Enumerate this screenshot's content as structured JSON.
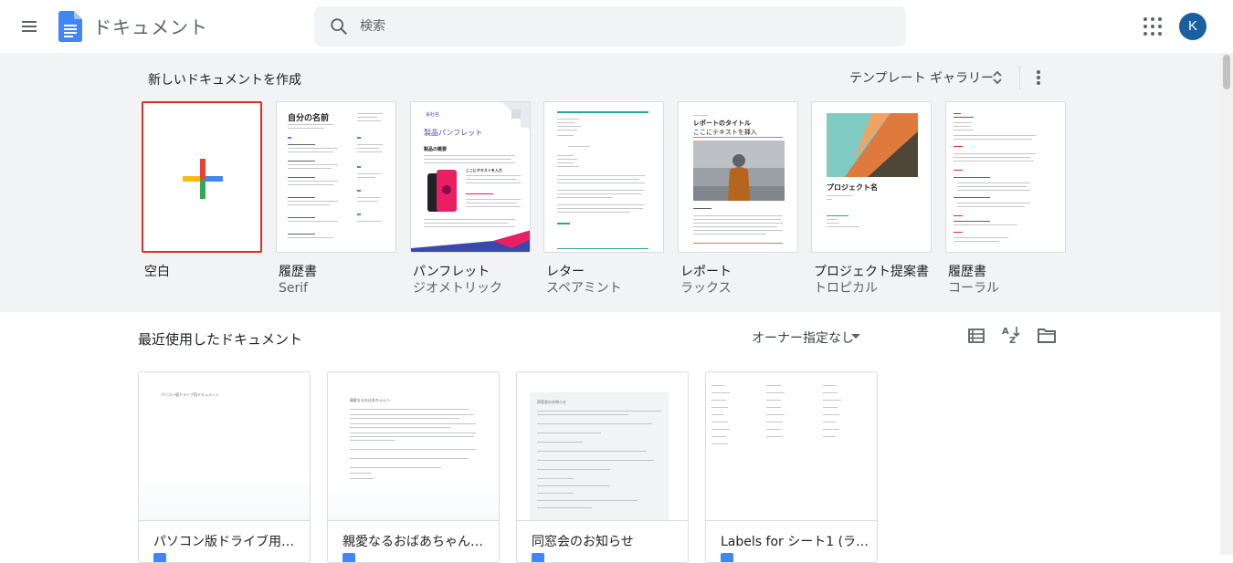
{
  "app": {
    "title": "ドキュメント",
    "avatar_letter": "K",
    "brand_color": "#4285f4"
  },
  "search": {
    "placeholder": "検索"
  },
  "templates": {
    "section_title": "新しいドキュメントを作成",
    "gallery_label": "テンプレート ギャラリー",
    "items": [
      {
        "name": "空白",
        "sub": ""
      },
      {
        "name": "履歴書",
        "sub": "Serif"
      },
      {
        "name": "パンフレット",
        "sub": "ジオメトリック"
      },
      {
        "name": "レター",
        "sub": "スペアミント"
      },
      {
        "name": "レポート",
        "sub": "ラックス"
      },
      {
        "name": "プロジェクト提案書",
        "sub": "トロピカル"
      },
      {
        "name": "履歴書",
        "sub": "コーラル"
      }
    ],
    "previews": {
      "resume_serif_name": "自分の名前",
      "brochure_company": "会社名",
      "brochure_title": "製品パンフレット",
      "brochure_heading": "製品の概要",
      "brochure_caption": "ここにテキストを入力",
      "report_title": "レポートのタイトル",
      "report_subtitle": "ここにテキストを挿入",
      "proposal_title": "プロジェクト名"
    }
  },
  "recent": {
    "section_title": "最近使用したドキュメント",
    "owner_filter": "オーナー指定なし",
    "docs": [
      {
        "title": "パソコン版ドライブ用ドキ…",
        "preview": "パソコン版ドライブ用ドキュメント"
      },
      {
        "title": "親愛なるおばあちゃんへ、",
        "preview": "親愛なるおばあちゃんへ"
      },
      {
        "title": "同窓会のお知らせ",
        "preview": "同窓会のお知らせ"
      },
      {
        "title": "Labels for シート1 (ラベル…",
        "preview": ""
      }
    ]
  }
}
